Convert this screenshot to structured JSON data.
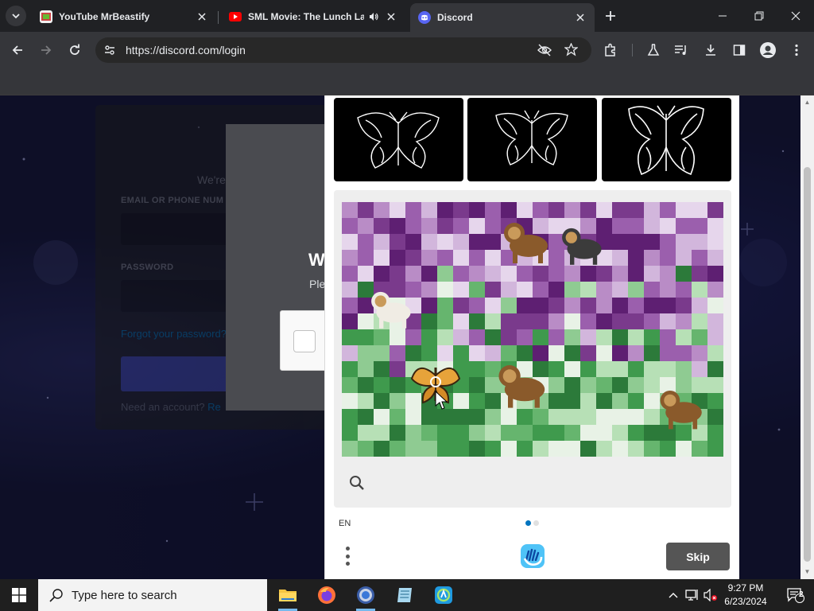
{
  "browser": {
    "tabs": [
      {
        "title": "YouTube MrBeastify",
        "favicon": "youtube-mrbeastify-icon",
        "active": false
      },
      {
        "title": "SML Movie: The Lunch Lad",
        "favicon": "youtube-icon",
        "active": false,
        "audio": true
      },
      {
        "title": "Discord",
        "favicon": "discord-icon",
        "active": true
      }
    ],
    "url": "https://discord.com/login"
  },
  "login": {
    "welcome": "We're",
    "email_label": "EMAIL OR PHONE NUM",
    "password_label": "PASSWORD",
    "forgot": "Forgot your password?",
    "need_account": "Need an account?",
    "register": "Re"
  },
  "modal": {
    "heading": "W",
    "subtext": "Ple"
  },
  "captcha": {
    "examples": [
      "butterfly-example-1",
      "butterfly-example-2",
      "butterfly-example-3"
    ],
    "language": "EN",
    "skip_label": "Skip",
    "progress": {
      "current": 1,
      "total": 2
    }
  },
  "taskbar": {
    "search_placeholder": "Type here to search",
    "time": "9:27 PM",
    "date": "6/23/2024",
    "notifications": "2"
  },
  "colors": {
    "discord_blurple": "#5865f2",
    "hcaptcha_blue": "#0074bf",
    "skip_button": "#555555"
  }
}
